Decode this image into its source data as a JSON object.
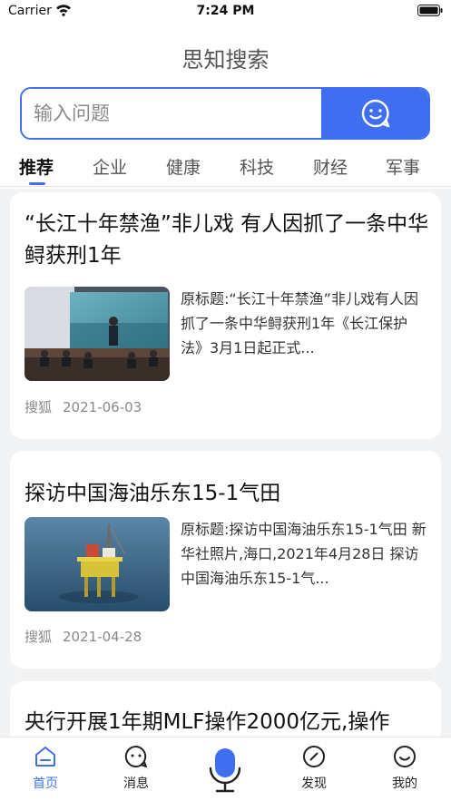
{
  "status_bar": {
    "carrier": "Carrier",
    "time": "7:24 PM"
  },
  "header": {
    "title": "思知搜索"
  },
  "search": {
    "placeholder": "输入问题",
    "value": ""
  },
  "tabs": [
    {
      "label": "推荐",
      "active": true
    },
    {
      "label": "企业"
    },
    {
      "label": "健康"
    },
    {
      "label": "科技"
    },
    {
      "label": "财经"
    },
    {
      "label": "军事"
    }
  ],
  "articles": [
    {
      "title": "“长江十年禁渔”非儿戏 有人因抓了一条中华鲟获刑1年",
      "snippet": "原标题:“长江十年禁渔”非儿戏有人因抓了一条中华鲟获刑1年《长江保护法》3月1日起正式...",
      "source": "搜狐",
      "date": "2021-06-03",
      "image": "press-conference-photo"
    },
    {
      "title": "探访中国海油乐东15-1气田",
      "snippet": "原标题:探访中国海油乐东15-1气田 新华社照片,海口,2021年4月28日 探访中国海油乐东15-1气...",
      "source": "搜狐",
      "date": "2021-04-28",
      "image": "offshore-gas-platform-photo"
    },
    {
      "title": "央行开展1年期MLF操作2000亿元,操作"
    }
  ],
  "bottom_nav": [
    {
      "label": "首页",
      "icon": "home-icon",
      "active": true
    },
    {
      "label": "消息",
      "icon": "message-icon"
    },
    {
      "label": "",
      "icon": "microphone-icon"
    },
    {
      "label": "发现",
      "icon": "compass-icon"
    },
    {
      "label": "我的",
      "icon": "profile-icon"
    }
  ],
  "colors": {
    "accent": "#3f6ff0",
    "background": "#f2f3f5",
    "card": "#ffffff"
  }
}
